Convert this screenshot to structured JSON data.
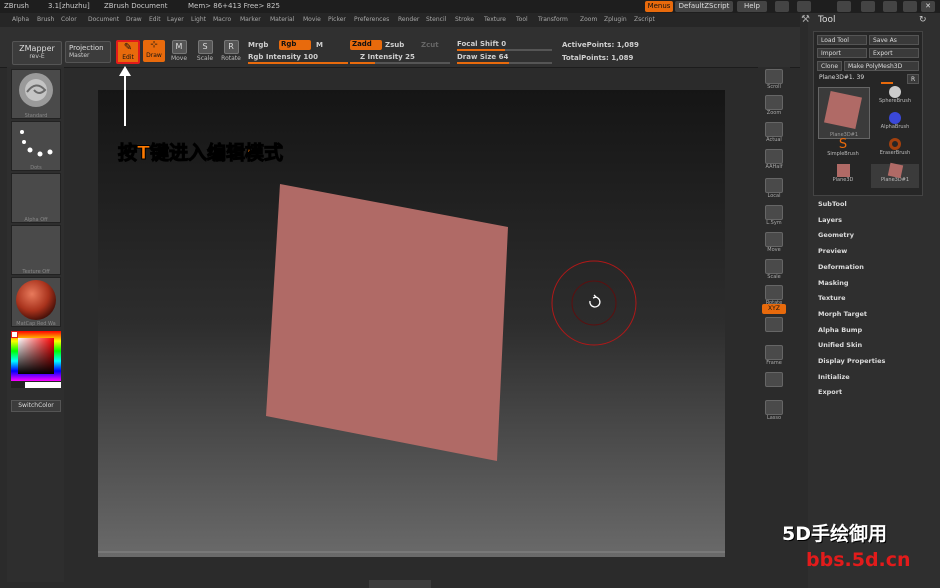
{
  "titlebar": {
    "app": "ZBrush",
    "version": "3.1[zhuzhu]",
    "doc": "ZBrush Document",
    "mem": "Mem> 86+413 Free> 825",
    "menus_btn": "Menus",
    "script_btn": "DefaultZScript",
    "help_btn": "Help"
  },
  "menubar": [
    "Alpha",
    "Brush",
    "Color",
    "Document",
    "Draw",
    "Edit",
    "Layer",
    "Light",
    "Macro",
    "Marker",
    "Material",
    "Movie",
    "Picker",
    "Preferences",
    "Render",
    "Stencil",
    "Stroke",
    "Texture",
    "Tool",
    "Transform",
    "Zoom",
    "Zplugin",
    "Zscript"
  ],
  "toolbar": {
    "zmapper": "ZMapper",
    "zmapper_sub": "rev-E",
    "projection": "Projection",
    "projection_sub": "Master",
    "edit": "Edit",
    "draw": "Draw",
    "move": "Move",
    "scale": "Scale",
    "rotate": "Rotate",
    "mrgb": "Mrgb",
    "rgb": "Rgb",
    "m": "M",
    "rgb_intensity": "Rgb Intensity 100",
    "zadd": "Zadd",
    "zsub": "Zsub",
    "zcut": "Zcut",
    "z_intensity": "Z Intensity 25",
    "focal_shift": "Focal Shift 0",
    "draw_size": "Draw Size 64",
    "active_points": "ActivePoints: 1,089",
    "total_points": "TotalPoints: 1,089",
    "rgb_intensity_level": 1.0,
    "z_intensity_level": 0.25,
    "focal_level": 0.5,
    "drawsize_level": 0.55
  },
  "leftshelf": {
    "standard": "Standard",
    "dots": "Dots",
    "alpha": "Alpha Off",
    "texture": "Texture Off",
    "material": "MatCap Red Wa",
    "switchcolor": "SwitchColor"
  },
  "rightshelf": [
    "Scroll",
    "Zoom",
    "Actual",
    "AAHalf",
    "Local",
    "L.Sym",
    "Move",
    "Scale",
    "Rotate",
    "XYZ",
    "",
    "Frame",
    "",
    "Lasso"
  ],
  "panel": {
    "title": "Tool",
    "load": "Load Tool",
    "save": "Save As",
    "import": "Import",
    "export": "Export",
    "clone": "Clone",
    "polymesh": "Make PolyMesh3D",
    "current": "Plane3D#1. 39",
    "r": "R",
    "brushes": [
      "Plane3D#1",
      "SphereBrush",
      "",
      "AlphaBrush",
      "SimpleBrush",
      "EraserBrush",
      "Plane3D",
      "Plane3D#1"
    ],
    "sections": [
      "SubTool",
      "Layers",
      "Geometry",
      "Preview",
      "Deformation",
      "Masking",
      "Texture",
      "Morph Target",
      "Alpha Bump",
      "Unified Skin",
      "Display Properties",
      "Initialize",
      "Export"
    ]
  },
  "annotation": {
    "pre": "按",
    "key": "T",
    "mid": "键进入",
    "hl": "编辑模式"
  },
  "watermark": {
    "line1": "5D手绘御用",
    "line2": "bbs.5d.cn"
  },
  "colors": {
    "accent": "#e86a0c",
    "plane": "#b06a66",
    "annotation_box": "#e21b1b"
  }
}
